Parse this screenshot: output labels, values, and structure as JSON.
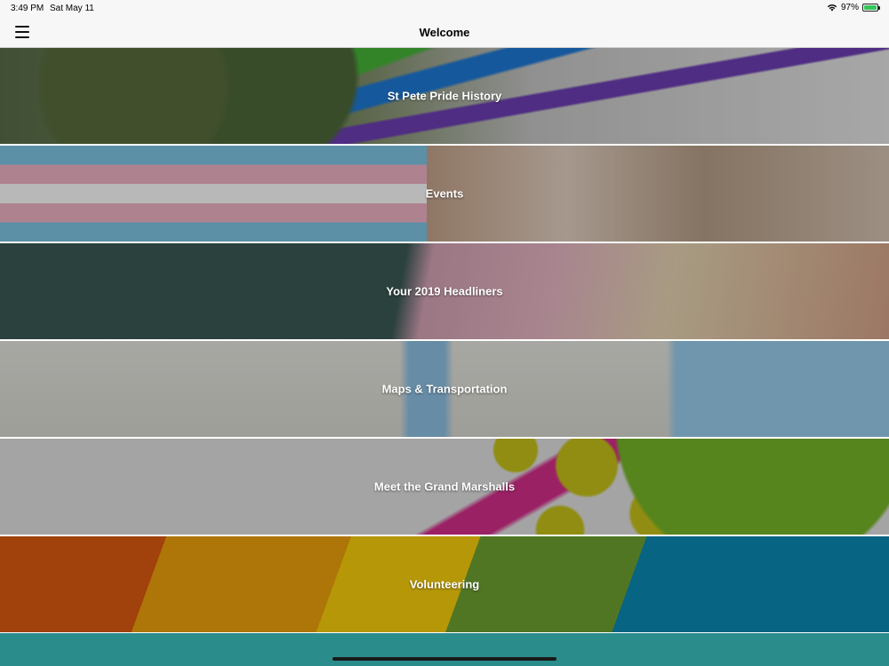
{
  "status_bar": {
    "time": "3:49 PM",
    "date": "Sat May 11",
    "battery": "97%",
    "battery_level": 0.97
  },
  "nav": {
    "title": "Welcome",
    "menu_icon": "hamburger-menu-icon"
  },
  "tiles": [
    {
      "label": "St Pete Pride History"
    },
    {
      "label": "Events"
    },
    {
      "label": "Your 2019 Headliners"
    },
    {
      "label": "Maps & Transportation"
    },
    {
      "label": "Meet the Grand Marshalls"
    },
    {
      "label": "Volunteering"
    }
  ],
  "colors": {
    "nav_bg": "#f7f7f7",
    "tile_divider": "#ffffff",
    "bottom_strip": "#2b8c8c"
  }
}
